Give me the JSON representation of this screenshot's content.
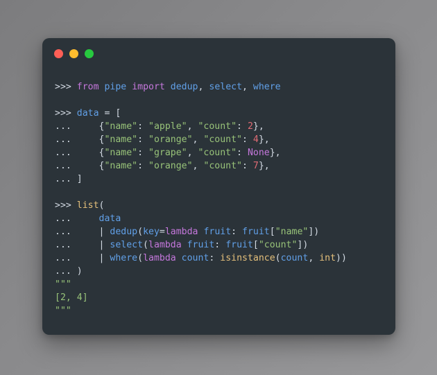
{
  "window": {
    "name": "python-repl-terminal",
    "background_color": "#2b3339",
    "page_background": "#8a8a8c",
    "traffic_lights": [
      {
        "name": "close",
        "label": "Close",
        "color": "#ff5f56"
      },
      {
        "name": "minimize",
        "label": "Minimize",
        "color": "#ffbd2e"
      },
      {
        "name": "maximize",
        "label": "Maximize",
        "color": "#27c93f"
      }
    ]
  },
  "palette": {
    "plain": "#d3dae3",
    "keyword": "#c678dd",
    "name": "#61a0e8",
    "string": "#98c379",
    "number": "#e06c75",
    "builtin": "#e5c07b",
    "constant": "#c678dd",
    "output": "#98c379"
  },
  "prompts": {
    "primary": ">>>",
    "continuation": "..."
  },
  "code": {
    "title": "pipe library REPL example",
    "lines": [
      {
        "id": "l1",
        "prompt": ">>>",
        "text": "from pipe import dedup, select, where",
        "tokens": [
          {
            "t": "from",
            "c": "kw"
          },
          {
            "t": " ",
            "c": "plain"
          },
          {
            "t": "pipe",
            "c": "name"
          },
          {
            "t": " ",
            "c": "plain"
          },
          {
            "t": "import",
            "c": "kw"
          },
          {
            "t": " ",
            "c": "plain"
          },
          {
            "t": "dedup",
            "c": "name"
          },
          {
            "t": ", ",
            "c": "plain"
          },
          {
            "t": "select",
            "c": "name"
          },
          {
            "t": ", ",
            "c": "plain"
          },
          {
            "t": "where",
            "c": "name"
          }
        ]
      },
      {
        "id": "l2",
        "prompt": "",
        "text": "",
        "tokens": []
      },
      {
        "id": "l3",
        "prompt": ">>>",
        "text": "data = [",
        "tokens": [
          {
            "t": "data",
            "c": "name"
          },
          {
            "t": " = [",
            "c": "plain"
          }
        ]
      },
      {
        "id": "l4",
        "prompt": "...",
        "text": "    {\"name\": \"apple\", \"count\": 2},",
        "tokens": [
          {
            "t": "    {",
            "c": "plain"
          },
          {
            "t": "\"name\"",
            "c": "str"
          },
          {
            "t": ": ",
            "c": "plain"
          },
          {
            "t": "\"apple\"",
            "c": "str"
          },
          {
            "t": ", ",
            "c": "plain"
          },
          {
            "t": "\"count\"",
            "c": "str"
          },
          {
            "t": ": ",
            "c": "plain"
          },
          {
            "t": "2",
            "c": "num"
          },
          {
            "t": "},",
            "c": "plain"
          }
        ]
      },
      {
        "id": "l5",
        "prompt": "...",
        "text": "    {\"name\": \"orange\", \"count\": 4},",
        "tokens": [
          {
            "t": "    {",
            "c": "plain"
          },
          {
            "t": "\"name\"",
            "c": "str"
          },
          {
            "t": ": ",
            "c": "plain"
          },
          {
            "t": "\"orange\"",
            "c": "str"
          },
          {
            "t": ", ",
            "c": "plain"
          },
          {
            "t": "\"count\"",
            "c": "str"
          },
          {
            "t": ": ",
            "c": "plain"
          },
          {
            "t": "4",
            "c": "num"
          },
          {
            "t": "},",
            "c": "plain"
          }
        ]
      },
      {
        "id": "l6",
        "prompt": "...",
        "text": "    {\"name\": \"grape\", \"count\": None},",
        "tokens": [
          {
            "t": "    {",
            "c": "plain"
          },
          {
            "t": "\"name\"",
            "c": "str"
          },
          {
            "t": ": ",
            "c": "plain"
          },
          {
            "t": "\"grape\"",
            "c": "str"
          },
          {
            "t": ", ",
            "c": "plain"
          },
          {
            "t": "\"count\"",
            "c": "str"
          },
          {
            "t": ": ",
            "c": "plain"
          },
          {
            "t": "None",
            "c": "const"
          },
          {
            "t": "},",
            "c": "plain"
          }
        ]
      },
      {
        "id": "l7",
        "prompt": "...",
        "text": "    {\"name\": \"orange\", \"count\": 7},",
        "tokens": [
          {
            "t": "    {",
            "c": "plain"
          },
          {
            "t": "\"name\"",
            "c": "str"
          },
          {
            "t": ": ",
            "c": "plain"
          },
          {
            "t": "\"orange\"",
            "c": "str"
          },
          {
            "t": ", ",
            "c": "plain"
          },
          {
            "t": "\"count\"",
            "c": "str"
          },
          {
            "t": ": ",
            "c": "plain"
          },
          {
            "t": "7",
            "c": "num"
          },
          {
            "t": "},",
            "c": "plain"
          }
        ]
      },
      {
        "id": "l8",
        "prompt": "...",
        "text": "]",
        "tokens": [
          {
            "t": "]",
            "c": "plain"
          }
        ]
      },
      {
        "id": "l9",
        "prompt": "",
        "text": "",
        "tokens": []
      },
      {
        "id": "l10",
        "prompt": ">>>",
        "text": "list(",
        "tokens": [
          {
            "t": "list",
            "c": "builtin"
          },
          {
            "t": "(",
            "c": "plain"
          }
        ]
      },
      {
        "id": "l11",
        "prompt": "...",
        "text": "    data",
        "tokens": [
          {
            "t": "    ",
            "c": "plain"
          },
          {
            "t": "data",
            "c": "name"
          }
        ]
      },
      {
        "id": "l12",
        "prompt": "...",
        "text": "    | dedup(key=lambda fruit: fruit[\"name\"])",
        "tokens": [
          {
            "t": "    | ",
            "c": "plain"
          },
          {
            "t": "dedup",
            "c": "name"
          },
          {
            "t": "(",
            "c": "plain"
          },
          {
            "t": "key",
            "c": "name"
          },
          {
            "t": "=",
            "c": "plain"
          },
          {
            "t": "lambda",
            "c": "kw"
          },
          {
            "t": " ",
            "c": "plain"
          },
          {
            "t": "fruit",
            "c": "name"
          },
          {
            "t": ": ",
            "c": "plain"
          },
          {
            "t": "fruit",
            "c": "name"
          },
          {
            "t": "[",
            "c": "plain"
          },
          {
            "t": "\"name\"",
            "c": "str"
          },
          {
            "t": "])",
            "c": "plain"
          }
        ]
      },
      {
        "id": "l13",
        "prompt": "...",
        "text": "    | select(lambda fruit: fruit[\"count\"])",
        "tokens": [
          {
            "t": "    | ",
            "c": "plain"
          },
          {
            "t": "select",
            "c": "name"
          },
          {
            "t": "(",
            "c": "plain"
          },
          {
            "t": "lambda",
            "c": "kw"
          },
          {
            "t": " ",
            "c": "plain"
          },
          {
            "t": "fruit",
            "c": "name"
          },
          {
            "t": ": ",
            "c": "plain"
          },
          {
            "t": "fruit",
            "c": "name"
          },
          {
            "t": "[",
            "c": "plain"
          },
          {
            "t": "\"count\"",
            "c": "str"
          },
          {
            "t": "])",
            "c": "plain"
          }
        ]
      },
      {
        "id": "l14",
        "prompt": "...",
        "text": "    | where(lambda count: isinstance(count, int))",
        "tokens": [
          {
            "t": "    | ",
            "c": "plain"
          },
          {
            "t": "where",
            "c": "name"
          },
          {
            "t": "(",
            "c": "plain"
          },
          {
            "t": "lambda",
            "c": "kw"
          },
          {
            "t": " ",
            "c": "plain"
          },
          {
            "t": "count",
            "c": "name"
          },
          {
            "t": ": ",
            "c": "plain"
          },
          {
            "t": "isinstance",
            "c": "builtin"
          },
          {
            "t": "(",
            "c": "plain"
          },
          {
            "t": "count",
            "c": "name"
          },
          {
            "t": ", ",
            "c": "plain"
          },
          {
            "t": "int",
            "c": "builtin"
          },
          {
            "t": "))",
            "c": "plain"
          }
        ]
      },
      {
        "id": "l15",
        "prompt": "...",
        "text": ")",
        "tokens": [
          {
            "t": ")",
            "c": "plain"
          }
        ]
      },
      {
        "id": "l16",
        "prompt": "",
        "text": "\"\"\"",
        "tokens": [
          {
            "t": "\"\"\"",
            "c": "out"
          }
        ]
      },
      {
        "id": "l17",
        "prompt": "",
        "text": "[2, 4]",
        "tokens": [
          {
            "t": "[2, 4]",
            "c": "out"
          }
        ]
      },
      {
        "id": "l18",
        "prompt": "",
        "text": "\"\"\"",
        "tokens": [
          {
            "t": "\"\"\"",
            "c": "out"
          }
        ]
      }
    ],
    "result": "[2, 4]"
  }
}
